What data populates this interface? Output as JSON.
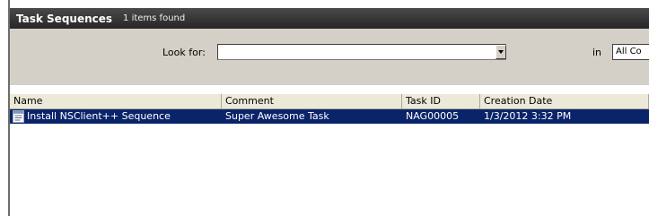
{
  "header": {
    "title": "Task Sequences",
    "count": "1 items found"
  },
  "search": {
    "look_for_label": "Look for:",
    "look_for_value": "",
    "in_label": "in",
    "in_value": "All Co"
  },
  "table": {
    "columns": [
      "Name",
      "Comment",
      "Task ID",
      "Creation Date"
    ],
    "rows": [
      {
        "icon": "task-sequence-icon",
        "name": "Install NSClient++ Sequence",
        "comment": "Super Awesome Task",
        "task_id": "NAG00005",
        "creation_date": "1/3/2012 3:32 PM",
        "selected": true
      }
    ]
  },
  "colors": {
    "titlebar": "#333333",
    "searchbar": "#d4d0c8",
    "selection": "#0a246a"
  }
}
